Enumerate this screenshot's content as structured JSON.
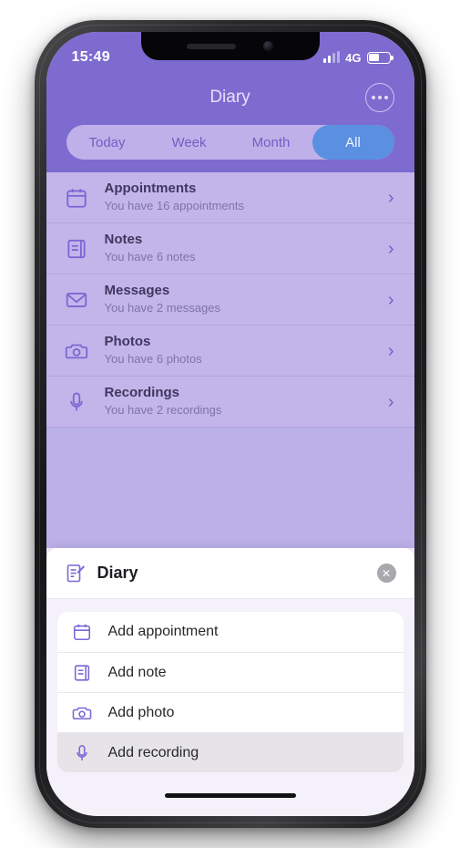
{
  "theme": {
    "header_purple": "#7d6bd0",
    "list_lavender": "#c3b5ea",
    "accent_blue": "#5b8fe0",
    "icon_purple": "#7b67d4"
  },
  "status_bar": {
    "time": "15:49",
    "network": "4G",
    "signal_bars_filled": 2,
    "signal_bars_total": 4,
    "battery_percent": 50
  },
  "nav": {
    "title": "Diary",
    "more_icon": "more-horizontal-icon"
  },
  "segmented_control": {
    "options": [
      {
        "label": "Today",
        "selected": false
      },
      {
        "label": "Week",
        "selected": false
      },
      {
        "label": "Month",
        "selected": false
      },
      {
        "label": "All",
        "selected": true
      }
    ]
  },
  "list": {
    "rows": [
      {
        "icon": "calendar-icon",
        "title": "Appointments",
        "subtitle": "You have 16 appointments",
        "chevron": "›"
      },
      {
        "icon": "notebook-icon",
        "title": "Notes",
        "subtitle": "You have 6 notes",
        "chevron": "›"
      },
      {
        "icon": "envelope-icon",
        "title": "Messages",
        "subtitle": "You have 2 messages",
        "chevron": "›"
      },
      {
        "icon": "camera-icon",
        "title": "Photos",
        "subtitle": "You have 6 photos",
        "chevron": "›"
      },
      {
        "icon": "microphone-icon",
        "title": "Recordings",
        "subtitle": "You have 2 recordings",
        "chevron": "›"
      }
    ]
  },
  "sheet": {
    "icon": "document-edit-icon",
    "title": "Diary",
    "close_label": "✕",
    "menu": [
      {
        "icon": "calendar-icon",
        "label": "Add appointment",
        "pressed": false
      },
      {
        "icon": "notebook-icon",
        "label": "Add note",
        "pressed": false
      },
      {
        "icon": "camera-icon",
        "label": "Add photo",
        "pressed": false
      },
      {
        "icon": "microphone-icon",
        "label": "Add recording",
        "pressed": true
      }
    ]
  }
}
